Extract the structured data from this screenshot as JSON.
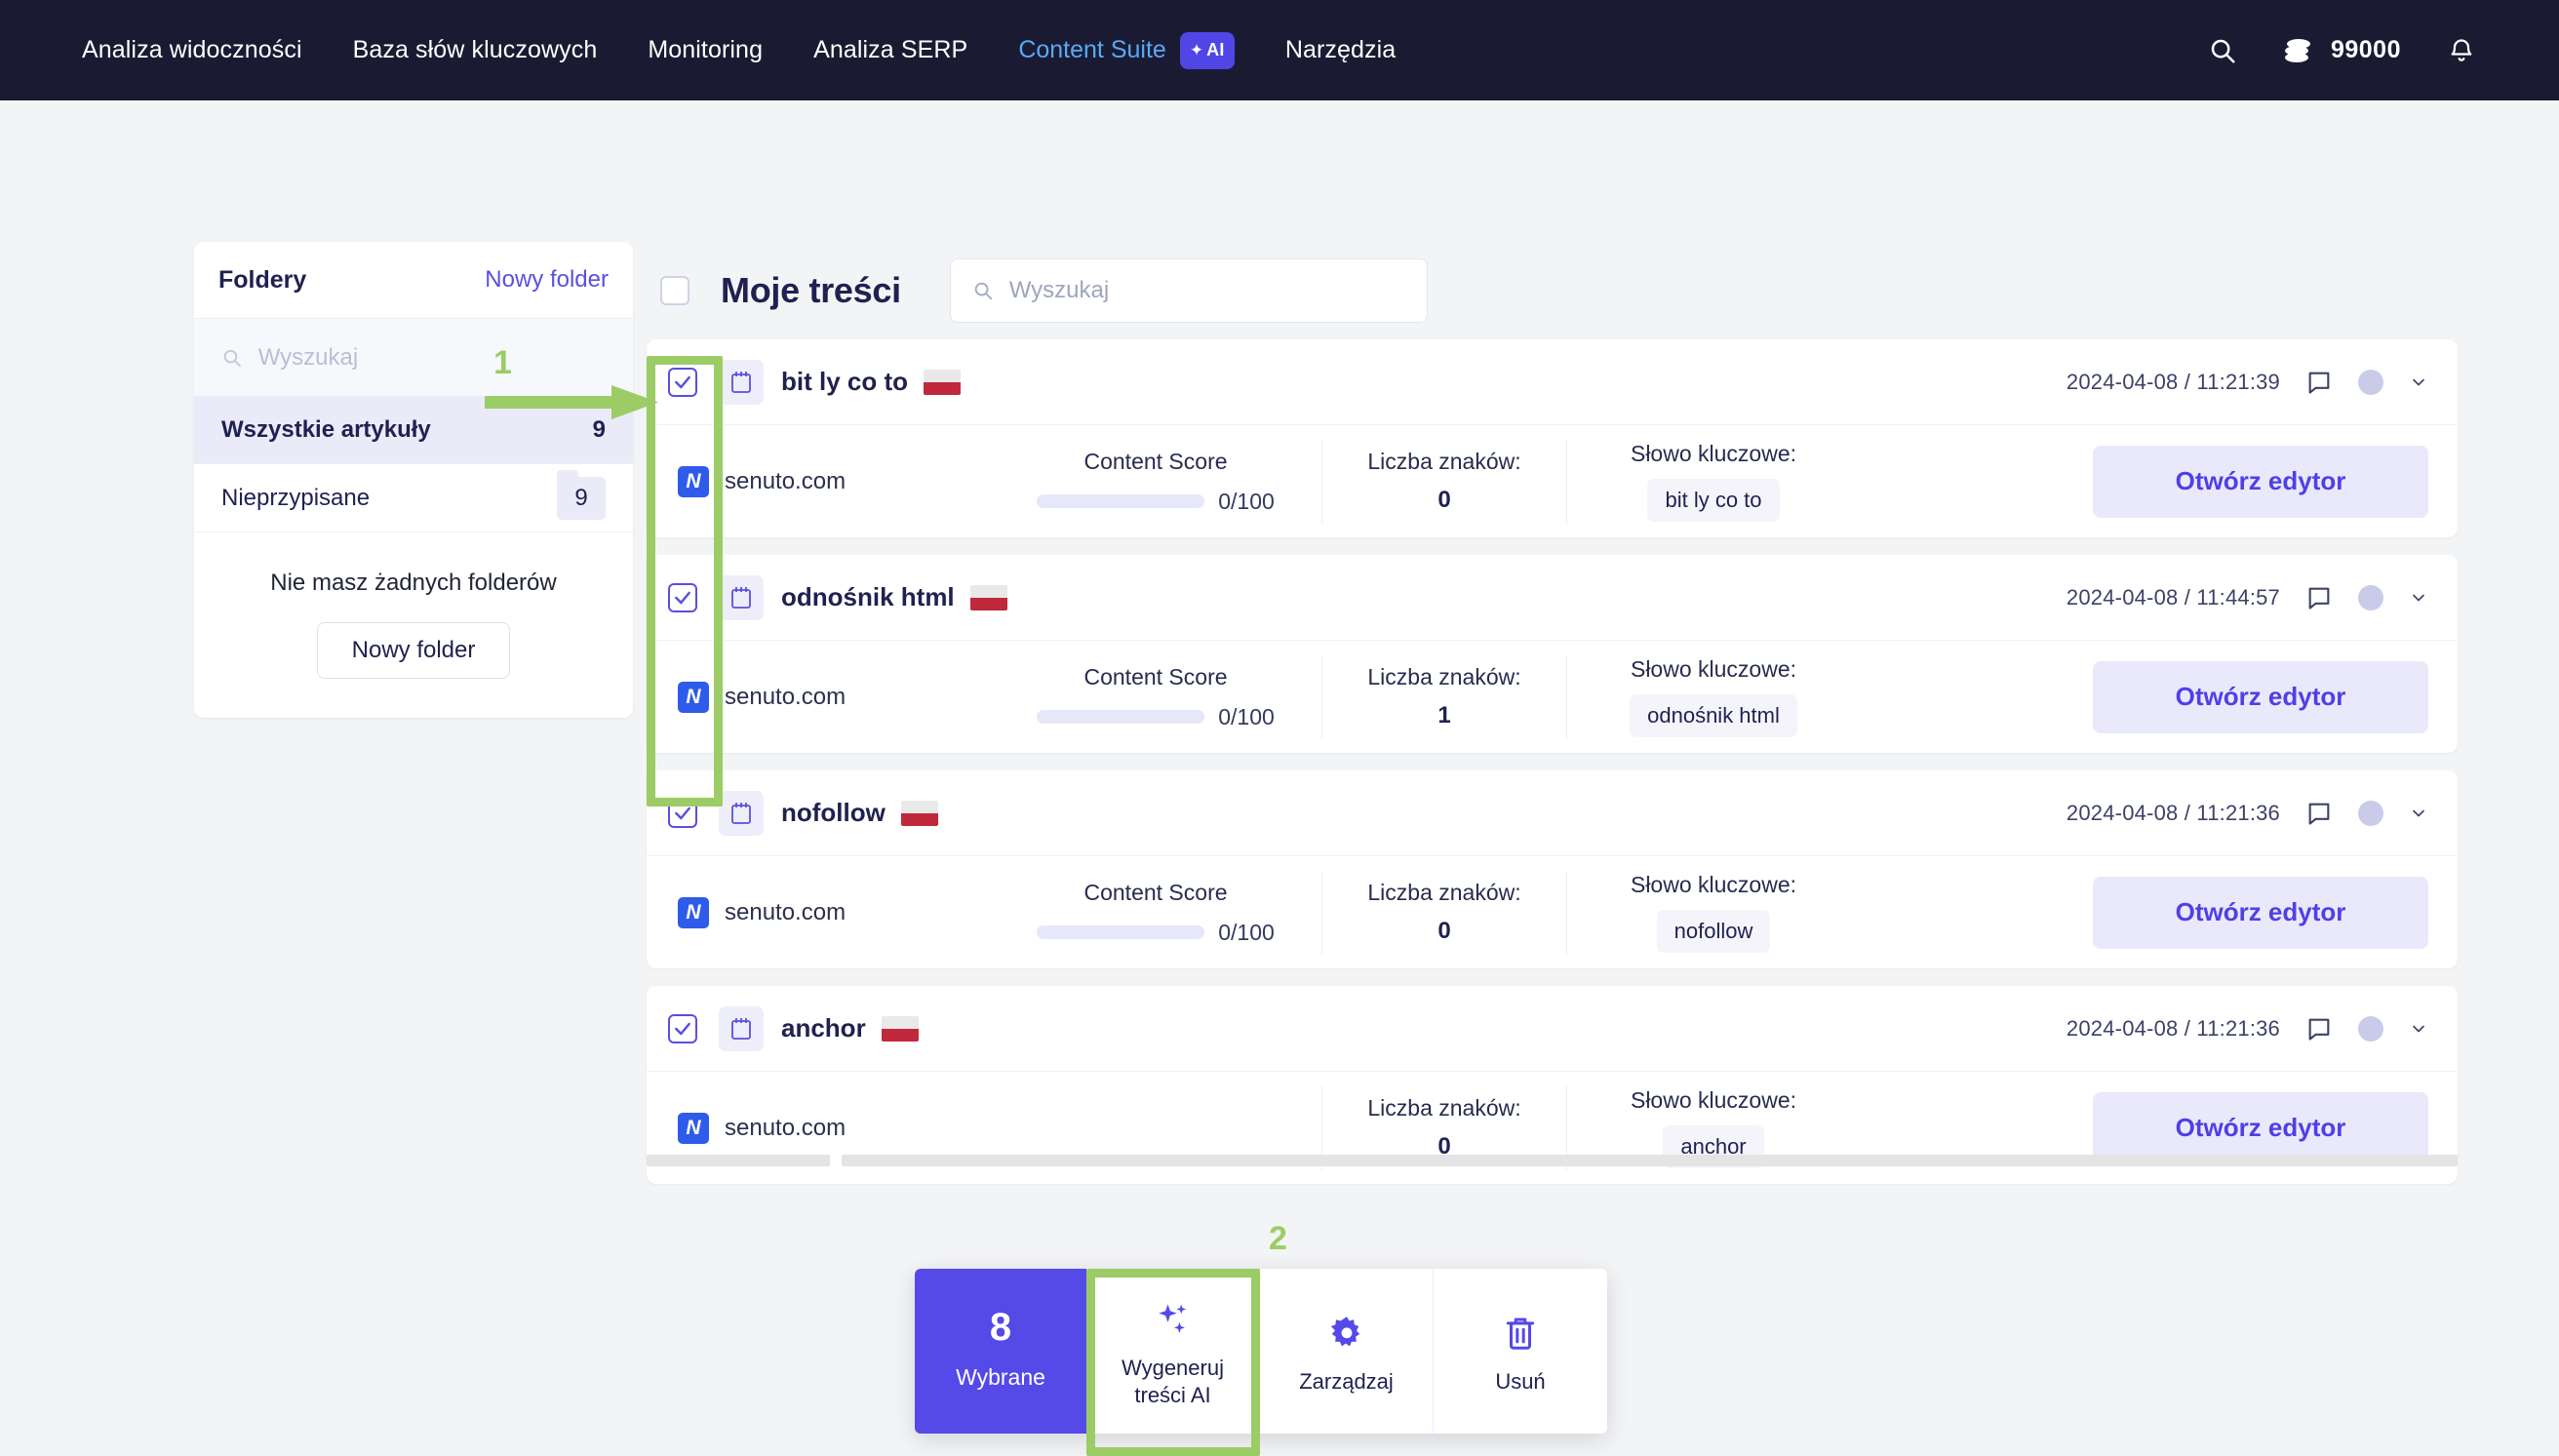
{
  "topnav": {
    "links": [
      {
        "label": "Analiza widoczności",
        "active": false
      },
      {
        "label": "Baza słów kluczowych",
        "active": false
      },
      {
        "label": "Monitoring",
        "active": false
      },
      {
        "label": "Analiza SERP",
        "active": false
      }
    ],
    "suite": {
      "label": "Content Suite",
      "badge": "AI",
      "badge_color": "#4f46e5"
    },
    "tools_label": "Narzędzia",
    "search_icon": "search-icon",
    "credits": {
      "icon": "coins-icon",
      "amount": "99000"
    },
    "bell_icon": "bell-icon"
  },
  "sidebar": {
    "title": "Foldery",
    "new_folder_link": "Nowy folder",
    "search_placeholder": "Wyszukaj",
    "search_value": "",
    "items": [
      {
        "label": "Wszystkie artykuły",
        "count": "9",
        "active": true,
        "badge": false
      },
      {
        "label": "Nieprzypisane",
        "count": "9",
        "active": false,
        "badge": true
      }
    ],
    "empty_text": "Nie masz żadnych folderów",
    "empty_button": "Nowy folder"
  },
  "main": {
    "title": "Moje treści",
    "select_all_checked": false,
    "search_placeholder": "Wyszukaj",
    "search_value": "",
    "labels": {
      "content_score": "Content Score",
      "char_count": "Liczba znaków:",
      "keyword": "Słowo kluczowe:",
      "open_editor": "Otwórz edytor"
    },
    "cards": [
      {
        "title": "bit ly co to",
        "flag": "pl-flag-icon",
        "checked": true,
        "timestamp": "2024-04-08 / 11:21:39",
        "site": "senuto.com",
        "site_logo": "senuto-logo-icon",
        "content_score": "0/100",
        "content_score_pct": 0,
        "char_count": "0",
        "keyword": "bit ly co to"
      },
      {
        "title": "odnośnik html",
        "flag": "pl-flag-icon",
        "checked": true,
        "timestamp": "2024-04-08 / 11:44:57",
        "site": "senuto.com",
        "site_logo": "senuto-logo-icon",
        "content_score": "0/100",
        "content_score_pct": 0,
        "char_count": "1",
        "keyword": "odnośnik html"
      },
      {
        "title": "nofollow",
        "flag": "pl-flag-icon",
        "checked": true,
        "timestamp": "2024-04-08 / 11:21:36",
        "site": "senuto.com",
        "site_logo": "senuto-logo-icon",
        "content_score": "0/100",
        "content_score_pct": 0,
        "char_count": "0",
        "keyword": "nofollow"
      },
      {
        "title": "anchor",
        "flag": "pl-flag-icon",
        "checked": true,
        "timestamp": "2024-04-08 / 11:21:36",
        "site": "senuto.com",
        "site_logo": "senuto-logo-icon",
        "content_score": "",
        "content_score_pct": 0,
        "char_count": "0",
        "keyword": "anchor"
      }
    ]
  },
  "actionbar": {
    "count": "8",
    "count_label": "Wybrane",
    "buttons": [
      {
        "label": "Wygeneruj\ntreści AI",
        "icon": "sparkles-icon"
      },
      {
        "label": "Zarządzaj",
        "icon": "gear-icon"
      },
      {
        "label": "Usuń",
        "icon": "trash-icon"
      }
    ]
  },
  "annotations": [
    {
      "id": "1",
      "label": "1",
      "color": "#9ccc65"
    },
    {
      "id": "2",
      "label": "2",
      "color": "#9ccc65"
    }
  ]
}
